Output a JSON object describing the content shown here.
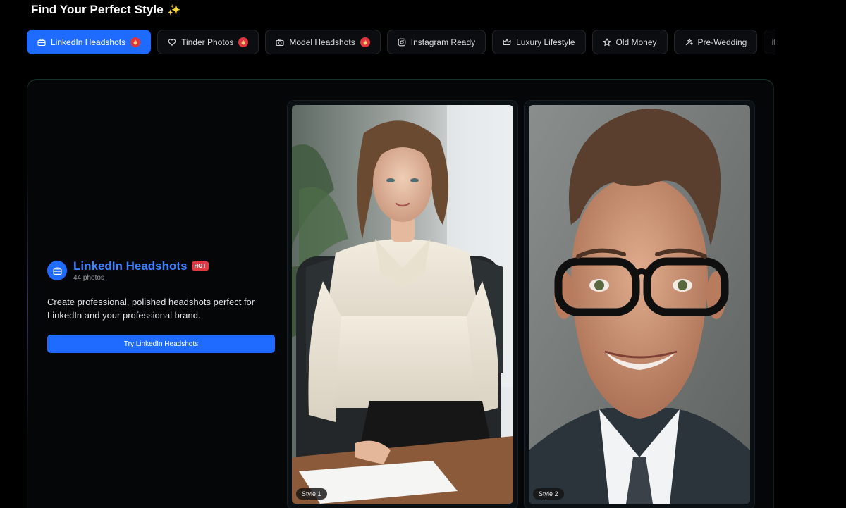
{
  "header": {
    "title": "Find Your Perfect Style",
    "sparkle": "✨"
  },
  "tabs": [
    {
      "label": "LinkedIn Headshots",
      "icon": "briefcase-icon",
      "hot": true,
      "active": true
    },
    {
      "label": "Tinder Photos",
      "icon": "heart-icon",
      "hot": true,
      "active": false
    },
    {
      "label": "Model Headshots",
      "icon": "camera-icon",
      "hot": true,
      "active": false
    },
    {
      "label": "Instagram Ready",
      "icon": "instagram-icon",
      "hot": false,
      "active": false
    },
    {
      "label": "Luxury Lifestyle",
      "icon": "crown-icon",
      "hot": false,
      "active": false
    },
    {
      "label": "Old Money",
      "icon": "star-icon",
      "hot": false,
      "active": false
    },
    {
      "label": "Pre-Wedding",
      "icon": "sparkles-icon",
      "hot": false,
      "active": false
    },
    {
      "label": "it",
      "icon": "partial-icon",
      "hot": false,
      "active": false
    }
  ],
  "feature": {
    "name": "LinkedIn Headshots",
    "badge": "HOT",
    "count": "44 photos",
    "description": "Create professional, polished headshots perfect for LinkedIn and your professional brand.",
    "button": "Try LinkedIn Headshots"
  },
  "photos": [
    {
      "label": "Style 1"
    },
    {
      "label": "Style 2"
    }
  ],
  "colors": {
    "accent": "#1f6bff",
    "hot": "#e23a44",
    "title_accent": "#3d82ff"
  }
}
